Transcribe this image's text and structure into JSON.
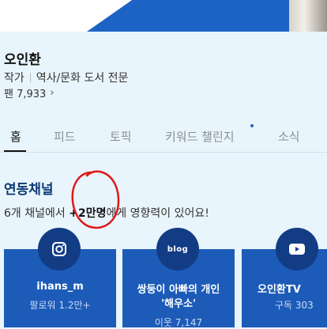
{
  "profile": {
    "name": "오인환",
    "role": "작가",
    "specialty": "역사/문화 도서 전문",
    "fans_label": "팬 7,933"
  },
  "tabs": [
    {
      "label": "홈",
      "active": true
    },
    {
      "label": "피드",
      "active": false
    },
    {
      "label": "토픽",
      "active": false
    },
    {
      "label": "키워드 챌린지",
      "active": false,
      "has_new_dot": true
    },
    {
      "label": "소식",
      "active": false
    }
  ],
  "linked_channels": {
    "title": "연동채널",
    "desc_prefix": "6개 채널에서 ",
    "desc_highlight": "+2만명",
    "desc_suffix": "에게 영향력이 있어요!",
    "annotation_color": "#e01818",
    "channels": [
      {
        "icon": "instagram-icon",
        "name": "ihans_m",
        "stat": "팔로워 1.2만+"
      },
      {
        "icon": "blog-icon",
        "badge_text": "blog",
        "name_line1": "쌍둥이 아빠의 개인",
        "name_line2": "'해우소'",
        "stat": "이웃 7,147"
      },
      {
        "icon": "youtube-icon",
        "name": "오인환TV",
        "stat": "구독 303"
      }
    ]
  },
  "colors": {
    "brand_blue": "#1d63c5",
    "card_blue": "#1d5bb8",
    "badge_blue": "#123d85",
    "background": "#e9f5fc"
  }
}
